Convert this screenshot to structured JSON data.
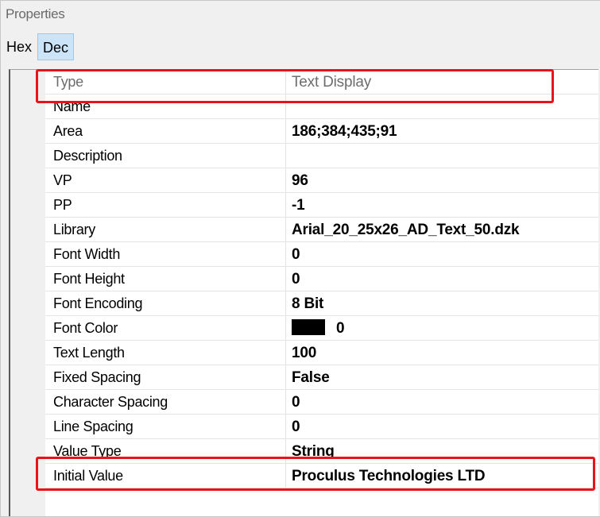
{
  "panel": {
    "title": "Properties"
  },
  "toolbar": {
    "hex_label": "Hex",
    "dec_label": "Dec"
  },
  "rows": [
    {
      "name": "Type",
      "value": "Text Display",
      "readonly": true,
      "highlighted": true
    },
    {
      "name": "Name",
      "value": ""
    },
    {
      "name": "Area",
      "value": "186;384;435;91"
    },
    {
      "name": "Description",
      "value": ""
    },
    {
      "name": "VP",
      "value": "96"
    },
    {
      "name": "PP",
      "value": "-1"
    },
    {
      "name": "Library",
      "value": "Arial_20_25x26_AD_Text_50.dzk"
    },
    {
      "name": "Font Width",
      "value": "0"
    },
    {
      "name": "Font Height",
      "value": "0"
    },
    {
      "name": "Font Encoding",
      "value": "8 Bit"
    },
    {
      "name": "Font Color",
      "value": "0",
      "swatch_color": "#000000"
    },
    {
      "name": "Text Length",
      "value": "100"
    },
    {
      "name": "Fixed Spacing",
      "value": "False"
    },
    {
      "name": "Character Spacing",
      "value": "0"
    },
    {
      "name": "Line Spacing",
      "value": "0"
    },
    {
      "name": "Value Type",
      "value": "String"
    },
    {
      "name": "Initial Value",
      "value": "Proculus Technologies LTD",
      "highlighted": true
    }
  ],
  "colors": {
    "highlight": "#e8141a",
    "selected_button": "#cce4f7",
    "panel_bg": "#f0f0f0"
  }
}
